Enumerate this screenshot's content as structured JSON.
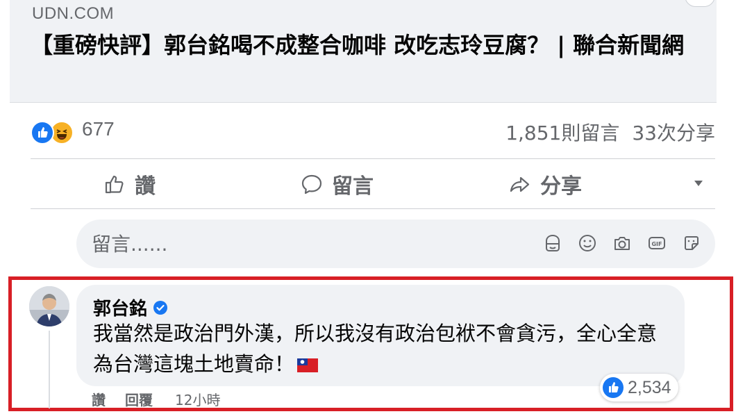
{
  "preview": {
    "domain": "UDN.COM",
    "title": "【重磅快評】郭台銘喝不成整合咖啡 改吃志玲豆腐？ | 聯合新聞網"
  },
  "summary": {
    "reaction_icons": [
      "like-icon",
      "haha-icon"
    ],
    "reaction_count": "677",
    "comments": "1,851則留言",
    "shares": "33次分享"
  },
  "actions": {
    "like_label": "讚",
    "comment_label": "留言",
    "share_label": "分享"
  },
  "composer": {
    "placeholder": "留言......",
    "icons": [
      "avatar-sticker-icon",
      "emoji-icon",
      "camera-icon",
      "gif-icon",
      "sticker-icon"
    ]
  },
  "comment": {
    "author": "郭台銘",
    "verified": true,
    "text": "我當然是政治門外漢，所以我沒有政治包袱不會貪污，全心全意為台灣這塊土地賣命！",
    "likes": "2,534",
    "like_action": "讚",
    "reply_action": "回覆",
    "timestamp": "12小時"
  },
  "colors": {
    "highlight_border": "#d81f26",
    "facebook_blue": "#1877f2",
    "secondary_text": "#65676b",
    "bubble_bg": "#f0f2f5"
  }
}
